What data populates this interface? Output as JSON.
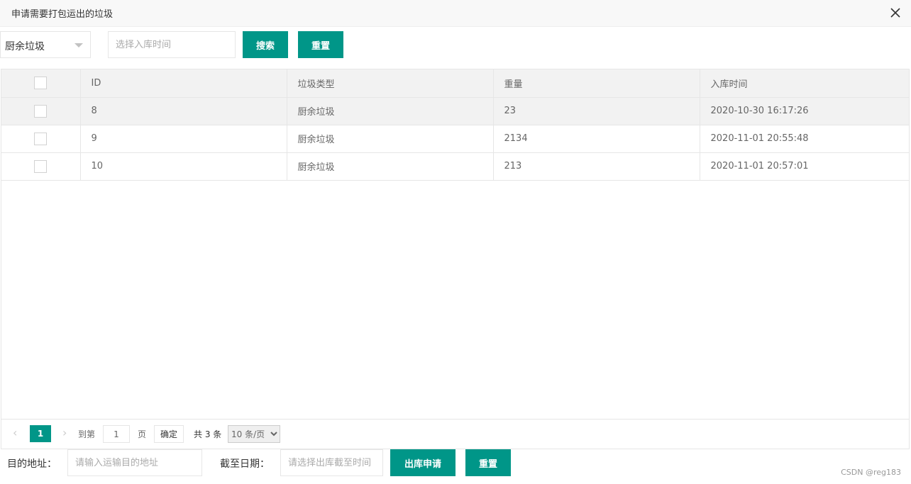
{
  "dialog": {
    "title": "申请需要打包运出的垃圾",
    "close_icon": "close-icon"
  },
  "toolbar": {
    "category_select_value": "厨余垃圾",
    "date_placeholder": "选择入库时间",
    "search_label": "搜索",
    "reset_label": "重置"
  },
  "table": {
    "columns": [
      "ID",
      "垃圾类型",
      "重量",
      "入库时间"
    ],
    "rows": [
      {
        "id": "8",
        "type": "厨余垃圾",
        "weight": "23",
        "time": "2020-10-30 16:17:26"
      },
      {
        "id": "9",
        "type": "厨余垃圾",
        "weight": "2134",
        "time": "2020-11-01 20:55:48"
      },
      {
        "id": "10",
        "type": "厨余垃圾",
        "weight": "213",
        "time": "2020-11-01 20:57:01"
      }
    ]
  },
  "pager": {
    "current_page": "1",
    "goto_label": "到第",
    "goto_value": "1",
    "page_unit": "页",
    "confirm_label": "确定",
    "total_label": "共 3 条",
    "page_size": "10 条/页"
  },
  "form": {
    "dest_label": "目的地址：",
    "dest_placeholder": "请输入运输目的地址",
    "deadline_label": "截至日期：",
    "deadline_placeholder": "请选择出库截至时间",
    "apply_label": "出库申请",
    "reset_label": "重置"
  },
  "watermark": "CSDN @reg183",
  "colors": {
    "accent": "#009688",
    "header_bg": "#f2f2f2",
    "border": "#e6e6e6"
  }
}
